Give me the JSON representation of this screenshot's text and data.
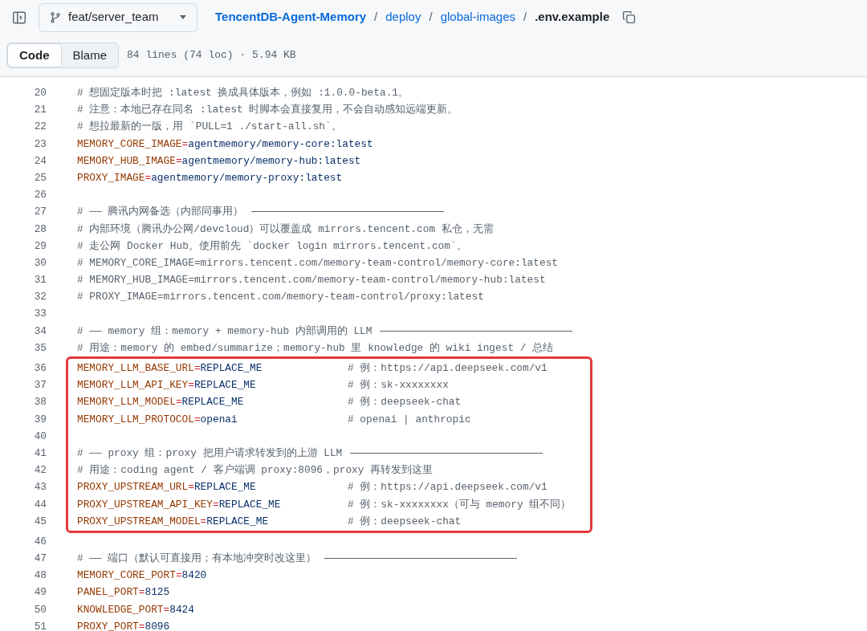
{
  "header": {
    "branch": "feat/server_team",
    "breadcrumb": [
      {
        "label": "TencentDB-Agent-Memory",
        "kind": "repo"
      },
      {
        "label": "deploy",
        "kind": "dir"
      },
      {
        "label": "global-images",
        "kind": "dir"
      },
      {
        "label": ".env.example",
        "kind": "file"
      }
    ],
    "separator": "/"
  },
  "toolbar": {
    "tabs": [
      {
        "label": "Code",
        "selected": true
      },
      {
        "label": "Blame",
        "selected": false
      }
    ],
    "file_info": "84 lines (74 loc) · 5.94 KB"
  },
  "blocks": [
    {
      "highlighted": false,
      "lines": [
        {
          "number": "20",
          "kind": "comment",
          "text": "# 想固定版本时把 :latest 换成具体版本，例如 :1.0.0-beta.1。"
        },
        {
          "number": "21",
          "kind": "comment",
          "text": "# 注意：本地已存在同名 :latest 时脚本会直接复用，不会自动感知远端更新。"
        },
        {
          "number": "22",
          "kind": "comment",
          "text": "# 想拉最新的一版，用 `PULL=1 ./start-all.sh`。"
        },
        {
          "number": "23",
          "kind": "assign",
          "key": "MEMORY_CORE_IMAGE",
          "eq": "=",
          "value": "agentmemory/memory-core:latest"
        },
        {
          "number": "24",
          "kind": "assign",
          "key": "MEMORY_HUB_IMAGE",
          "eq": "=",
          "value": "agentmemory/memory-hub:latest"
        },
        {
          "number": "25",
          "kind": "assign",
          "key": "PROXY_IMAGE",
          "eq": "=",
          "value": "agentmemory/memory-proxy:latest"
        },
        {
          "number": "26",
          "kind": "blank"
        },
        {
          "number": "27",
          "kind": "section",
          "text": "# —— 腾讯内网备选（内部同事用）"
        },
        {
          "number": "28",
          "kind": "comment",
          "text": "# 内部环境（腾讯办公网/devcloud）可以覆盖成 mirrors.tencent.com 私仓，无需"
        },
        {
          "number": "29",
          "kind": "comment",
          "text": "# 走公网 Docker Hub。使用前先 `docker login mirrors.tencent.com`。"
        },
        {
          "number": "30",
          "kind": "comment",
          "text": "# MEMORY_CORE_IMAGE=mirrors.tencent.com/memory-team-control/memory-core:latest"
        },
        {
          "number": "31",
          "kind": "comment",
          "text": "# MEMORY_HUB_IMAGE=mirrors.tencent.com/memory-team-control/memory-hub:latest"
        },
        {
          "number": "32",
          "kind": "comment",
          "text": "# PROXY_IMAGE=mirrors.tencent.com/memory-team-control/proxy:latest"
        },
        {
          "number": "33",
          "kind": "blank"
        },
        {
          "number": "34",
          "kind": "section",
          "text": "# —— memory 组：memory + memory-hub 内部调用的 LLM"
        },
        {
          "number": "35",
          "kind": "comment",
          "text": "# 用途：memory 的 embed/summarize；memory-hub 里 knowledge 的 wiki ingest / 总结"
        }
      ]
    },
    {
      "highlighted": true,
      "lines": [
        {
          "number": "36",
          "kind": "assign",
          "key": "MEMORY_LLM_BASE_URL",
          "eq": "=",
          "value": "REPLACE_ME",
          "comment": "# 例：https://api.deepseek.com/v1"
        },
        {
          "number": "37",
          "kind": "assign",
          "key": "MEMORY_LLM_API_KEY",
          "eq": "=",
          "value": "REPLACE_ME",
          "comment": "# 例：sk-xxxxxxxx"
        },
        {
          "number": "38",
          "kind": "assign",
          "key": "MEMORY_LLM_MODEL",
          "eq": "=",
          "value": "REPLACE_ME",
          "comment": "# 例：deepseek-chat"
        },
        {
          "number": "39",
          "kind": "assign",
          "key": "MEMORY_LLM_PROTOCOL",
          "eq": "=",
          "value": "openai",
          "comment": "# openai | anthropic"
        },
        {
          "number": "40",
          "kind": "blank"
        },
        {
          "number": "41",
          "kind": "section",
          "text": "# —— proxy 组：proxy 把用户请求转发到的上游 LLM"
        },
        {
          "number": "42",
          "kind": "comment",
          "text": "# 用途：coding agent / 客户端调 proxy:8096，proxy 再转发到这里"
        },
        {
          "number": "43",
          "kind": "assign",
          "key": "PROXY_UPSTREAM_URL",
          "eq": "=",
          "value": "REPLACE_ME",
          "comment": "# 例：https://api.deepseek.com/v1"
        },
        {
          "number": "44",
          "kind": "assign",
          "key": "PROXY_UPSTREAM_API_KEY",
          "eq": "=",
          "value": "REPLACE_ME",
          "comment": "# 例：sk-xxxxxxxx（可与 memory 组不同）"
        },
        {
          "number": "45",
          "kind": "assign",
          "key": "PROXY_UPSTREAM_MODEL",
          "eq": "=",
          "value": "REPLACE_ME",
          "comment": "# 例：deepseek-chat"
        }
      ]
    },
    {
      "highlighted": false,
      "lines": [
        {
          "number": "46",
          "kind": "blank"
        },
        {
          "number": "47",
          "kind": "section",
          "text": "# —— 端口（默认可直接用；有本地冲突时改这里）"
        },
        {
          "number": "48",
          "kind": "assign",
          "key": "MEMORY_CORE_PORT",
          "eq": "=",
          "value": "8420"
        },
        {
          "number": "49",
          "kind": "assign",
          "key": "PANEL_PORT",
          "eq": "=",
          "value": "8125"
        },
        {
          "number": "50",
          "kind": "assign",
          "key": "KNOWLEDGE_PORT",
          "eq": "=",
          "value": "8424"
        },
        {
          "number": "51",
          "kind": "assign",
          "key": "PROXY_PORT",
          "eq": "=",
          "value": "8096"
        }
      ]
    }
  ]
}
